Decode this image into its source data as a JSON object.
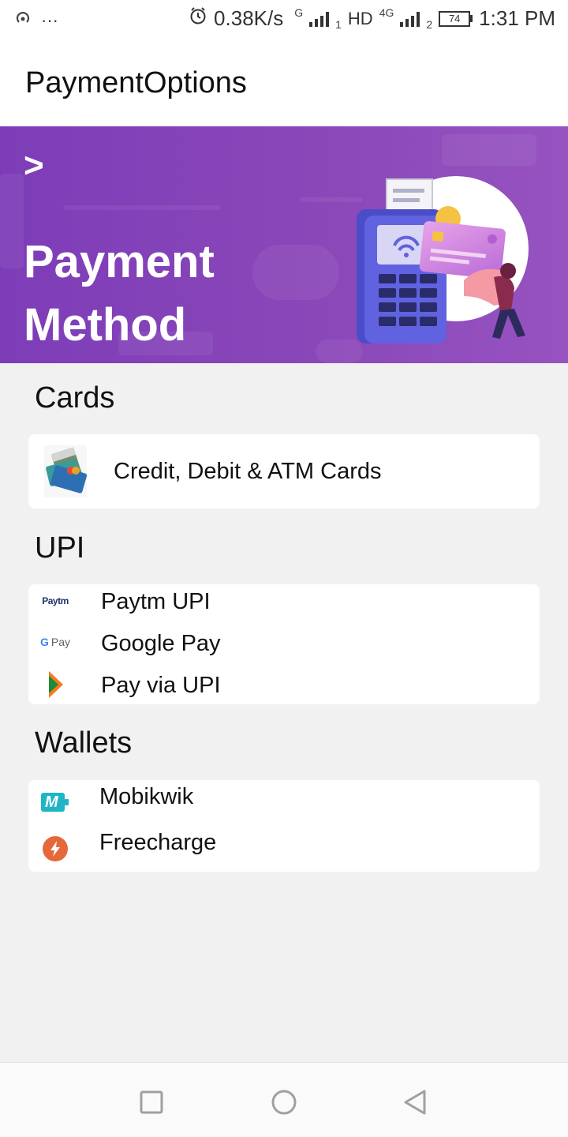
{
  "status_bar": {
    "dots": "···",
    "speed": "0.38K/s",
    "net1": "G",
    "sim1": "1",
    "hd": "HD",
    "net2": "4G",
    "sim2": "2",
    "battery": "74",
    "time": "1:31 PM"
  },
  "app_bar": {
    "title": "PaymentOptions"
  },
  "banner": {
    "arrow": ">",
    "heading_line1": "Payment",
    "heading_line2": "Method"
  },
  "sections": {
    "cards": {
      "title": "Cards",
      "items": [
        {
          "label": "Credit, Debit & ATM Cards",
          "icon": "credit-cards-icon"
        }
      ]
    },
    "upi": {
      "title": "UPI",
      "items": [
        {
          "label": "Paytm UPI",
          "icon": "paytm-icon",
          "logo_text": "Paytm"
        },
        {
          "label": "Google Pay",
          "icon": "google-pay-icon",
          "logo_text": "Pay",
          "logo_g": "G"
        },
        {
          "label": "Pay via UPI",
          "icon": "upi-icon"
        }
      ]
    },
    "wallets": {
      "title": "Wallets",
      "items": [
        {
          "label": "Mobikwik",
          "icon": "mobikwik-icon",
          "logo_text": "M"
        },
        {
          "label": "Freecharge",
          "icon": "freecharge-icon"
        }
      ]
    }
  },
  "colors": {
    "banner_purple": "#8a47b8",
    "paytm_blue": "#00b9f1",
    "paytm_navy": "#20336b",
    "upi_orange": "#f47b20",
    "upi_green": "#1b8a3a",
    "mobikwik_teal": "#1fb5c6",
    "freecharge_orange": "#e5683a"
  }
}
